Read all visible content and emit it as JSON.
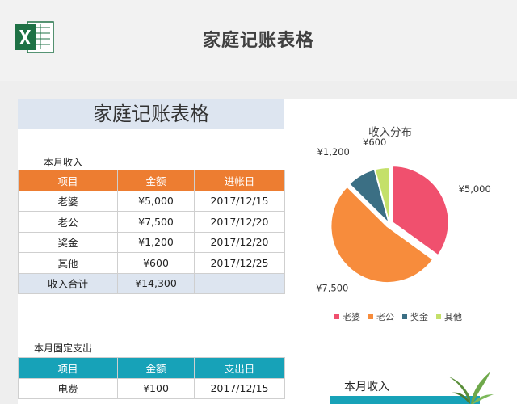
{
  "header": {
    "title": "家庭记账表格",
    "logo_icon": "excel-icon"
  },
  "sheet": {
    "title": "家庭记账表格",
    "income": {
      "label": "本月收入",
      "headers": [
        "项目",
        "金额",
        "进帐日"
      ],
      "rows": [
        [
          "老婆",
          "¥5,000",
          "2017/12/15"
        ],
        [
          "老公",
          "¥7,500",
          "2017/12/20"
        ],
        [
          "奖金",
          "¥1,200",
          "2017/12/20"
        ],
        [
          "其他",
          "¥600",
          "2017/12/25"
        ]
      ],
      "total": [
        "收入合计",
        "¥14,300",
        ""
      ]
    },
    "expense": {
      "label": "本月固定支出",
      "headers": [
        "项目",
        "金额",
        "支出日"
      ],
      "rows": [
        [
          "电费",
          "¥100",
          "2017/12/15"
        ]
      ]
    },
    "card": {
      "title": "本月收入"
    }
  },
  "colors": {
    "income_header": "#ed7d31",
    "expense_header": "#17a2b8",
    "band": "#dde5f0"
  },
  "chart_data": {
    "type": "pie",
    "title": "收入分布",
    "categories": [
      "老婆",
      "老公",
      "奖金",
      "其他"
    ],
    "values": [
      5000,
      7500,
      1200,
      600
    ],
    "labels": [
      "¥5,000",
      "¥7,500",
      "¥1,200",
      "¥600"
    ],
    "colors": [
      "#f0506e",
      "#f78c3c",
      "#3b6f84",
      "#c4e06a"
    ],
    "legend": "bottom"
  }
}
